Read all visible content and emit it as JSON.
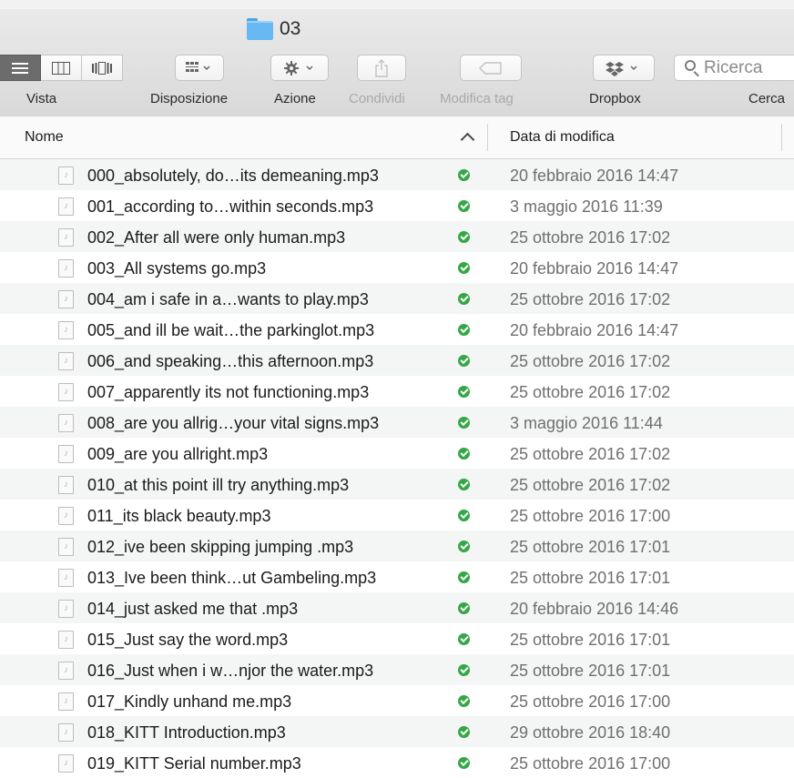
{
  "window": {
    "title": "03"
  },
  "toolbar": {
    "vista_label": "Vista",
    "disposizione_label": "Disposizione",
    "azione_label": "Azione",
    "condividi_label": "Condividi",
    "modifica_tag_label": "Modifica tag",
    "dropbox_label": "Dropbox",
    "cerca_label": "Cerca",
    "search_placeholder": "Ricerca",
    "icons": {
      "list_view": "list-view-icon",
      "column_view": "column-view-icon",
      "coverflow_view": "coverflow-view-icon",
      "arrange": "arrange-icon",
      "action": "gear-icon",
      "share": "share-icon",
      "tag": "tag-icon",
      "dropbox": "dropbox-icon",
      "search": "search-icon"
    }
  },
  "columns": {
    "name": "Nome",
    "date": "Data di modifica"
  },
  "files": [
    {
      "name": "000_absolutely, do…its demeaning.mp3",
      "date": "20 febbraio 2016 14:47"
    },
    {
      "name": "001_according to…within seconds.mp3",
      "date": "3 maggio 2016 11:39"
    },
    {
      "name": "002_After all were only human.mp3",
      "date": "25 ottobre 2016 17:02"
    },
    {
      "name": "003_All systems go.mp3",
      "date": "20 febbraio 2016 14:47"
    },
    {
      "name": "004_am i safe in a…wants to play.mp3",
      "date": "25 ottobre 2016 17:02"
    },
    {
      "name": "005_and ill be wait…the parkinglot.mp3",
      "date": "20 febbraio 2016 14:47"
    },
    {
      "name": "006_and speaking…this afternoon.mp3",
      "date": "25 ottobre 2016 17:02"
    },
    {
      "name": "007_apparently its not functioning.mp3",
      "date": "25 ottobre 2016 17:02"
    },
    {
      "name": "008_are you allrig…your vital signs.mp3",
      "date": "3 maggio 2016 11:44"
    },
    {
      "name": "009_are you allright.mp3",
      "date": "25 ottobre 2016 17:02"
    },
    {
      "name": "010_at this point ill try anything.mp3",
      "date": "25 ottobre 2016 17:02"
    },
    {
      "name": "011_its black beauty.mp3",
      "date": "25 ottobre 2016 17:00"
    },
    {
      "name": "012_ive been skipping jumping .mp3",
      "date": "25 ottobre 2016 17:01"
    },
    {
      "name": "013_Ive been think…ut Gambeling.mp3",
      "date": "25 ottobre 2016 17:01"
    },
    {
      "name": "014_just asked me that .mp3",
      "date": "20 febbraio 2016 14:46"
    },
    {
      "name": "015_Just say the word.mp3",
      "date": "25 ottobre 2016 17:01"
    },
    {
      "name": "016_Just when i w…njor the water.mp3",
      "date": "25 ottobre 2016 17:01"
    },
    {
      "name": "017_Kindly unhand me.mp3",
      "date": "25 ottobre 2016 17:00"
    },
    {
      "name": "018_KITT Introduction.mp3",
      "date": "29 ottobre 2016 18:40"
    },
    {
      "name": "019_KITT Serial number.mp3",
      "date": "25 ottobre 2016 17:00"
    }
  ],
  "colors": {
    "sync_ok": "#35a745",
    "folder": "#68b9f3"
  }
}
